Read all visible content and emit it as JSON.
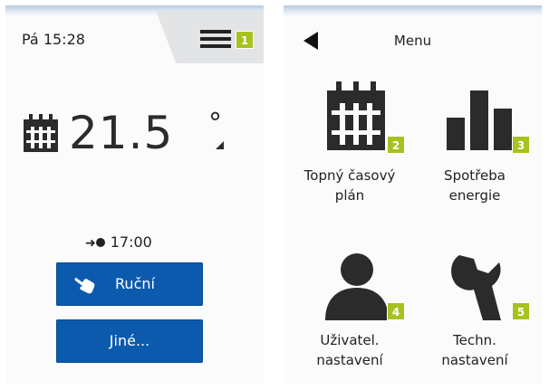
{
  "status": {
    "datetime": "Pá 15:28",
    "menu_badge": "1"
  },
  "thermostat": {
    "temperature": "21.5",
    "degree_symbol": "°",
    "next_change_time": "17:00",
    "next_change_arrow": "➜"
  },
  "buttons": {
    "manual": "Ruční",
    "other": "Jiné..."
  },
  "menu": {
    "title": "Menu",
    "items": [
      {
        "line1": "Topný časový",
        "line2": "plán",
        "badge": "2",
        "icon": "calendar-icon"
      },
      {
        "line1": "Spotřeba",
        "line2": "energie",
        "badge": "3",
        "icon": "bar-chart-icon"
      },
      {
        "line1": "Uživatel.",
        "line2": "nastavení",
        "badge": "4",
        "icon": "user-icon"
      },
      {
        "line1": "Techn.",
        "line2": "nastavení",
        "badge": "5",
        "icon": "wrench-icon"
      }
    ]
  },
  "colors": {
    "button_blue": "#0c5aad",
    "badge_green": "#a6c21d",
    "icon_dark": "#2b2b2b"
  }
}
